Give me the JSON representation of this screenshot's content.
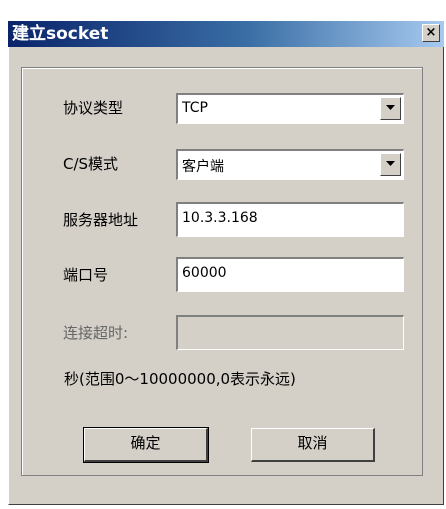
{
  "window": {
    "title": "建立socket",
    "close_symbol": "×"
  },
  "form": {
    "protocol": {
      "label": "协议类型",
      "value": "TCP"
    },
    "mode": {
      "label": "C/S模式",
      "value": "客户端"
    },
    "server_address": {
      "label": "服务器地址",
      "value": "10.3.3.168"
    },
    "port": {
      "label": "端口号",
      "value": "60000"
    },
    "timeout": {
      "label": "连接超时:",
      "value": ""
    },
    "timeout_hint": "秒(范围0～10000000,0表示永远)"
  },
  "buttons": {
    "ok": "确定",
    "cancel": "取消"
  },
  "icons": {
    "dropdown": "triangle-down-icon",
    "close": "close-icon"
  }
}
